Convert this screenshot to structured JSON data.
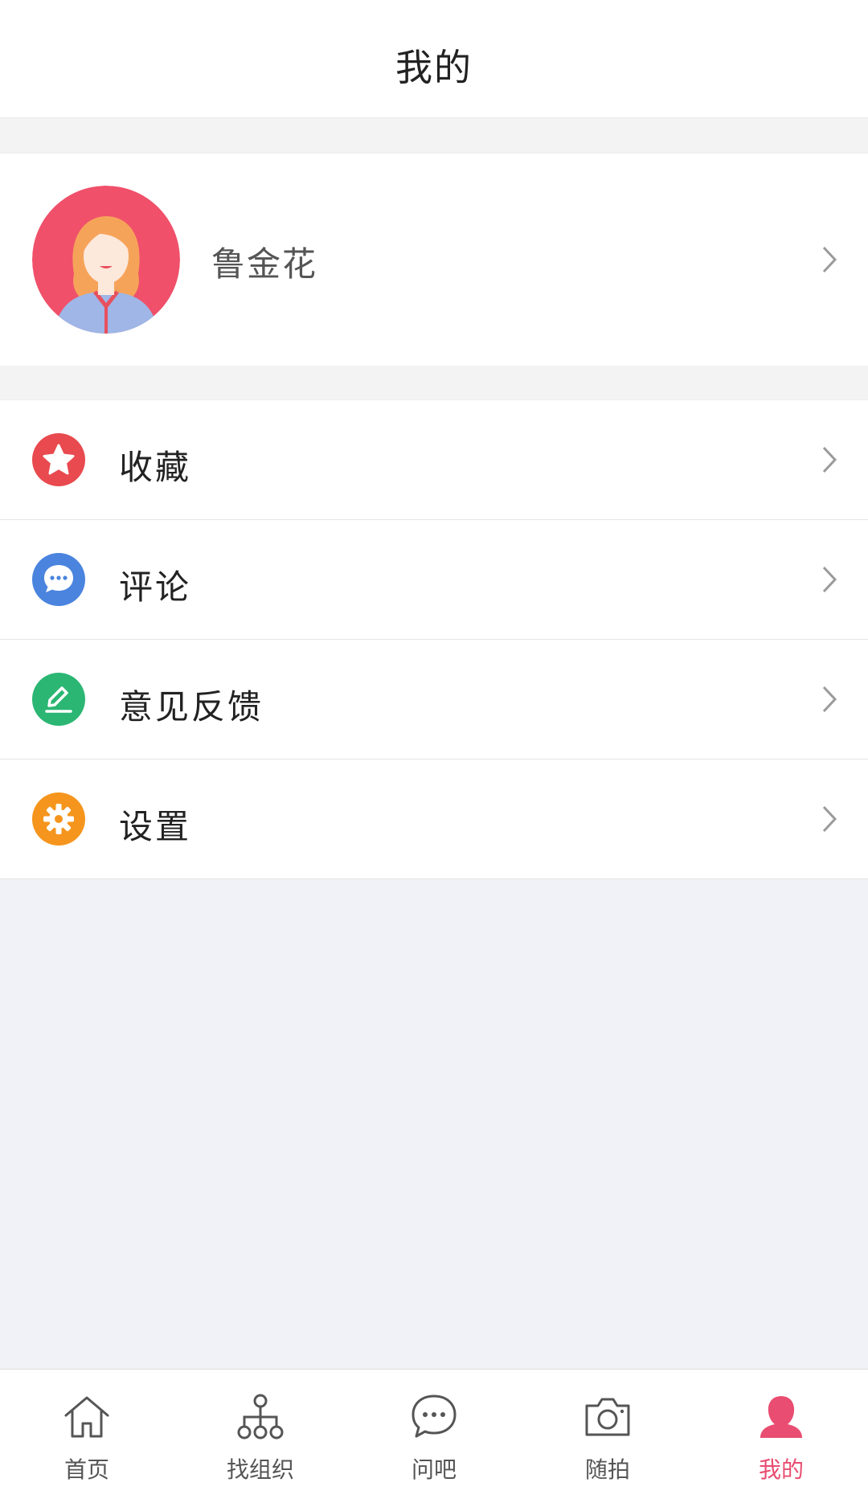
{
  "header": {
    "title": "我的"
  },
  "profile": {
    "name": "鲁金花"
  },
  "menu": {
    "items": [
      {
        "label": "收藏",
        "icon": "star-icon",
        "color": "#e84a4f"
      },
      {
        "label": "评论",
        "icon": "comment-icon",
        "color": "#4a84de"
      },
      {
        "label": "意见反馈",
        "icon": "edit-icon",
        "color": "#2bb673"
      },
      {
        "label": "设置",
        "icon": "gear-icon",
        "color": "#f5951d"
      }
    ]
  },
  "tabbar": {
    "active_color": "#e94d71",
    "tabs": [
      {
        "label": "首页",
        "icon": "home-icon"
      },
      {
        "label": "找组织",
        "icon": "org-tree-icon"
      },
      {
        "label": "问吧",
        "icon": "chat-bubble-icon"
      },
      {
        "label": "随拍",
        "icon": "camera-icon"
      },
      {
        "label": "我的",
        "icon": "person-icon",
        "active": true
      }
    ]
  }
}
